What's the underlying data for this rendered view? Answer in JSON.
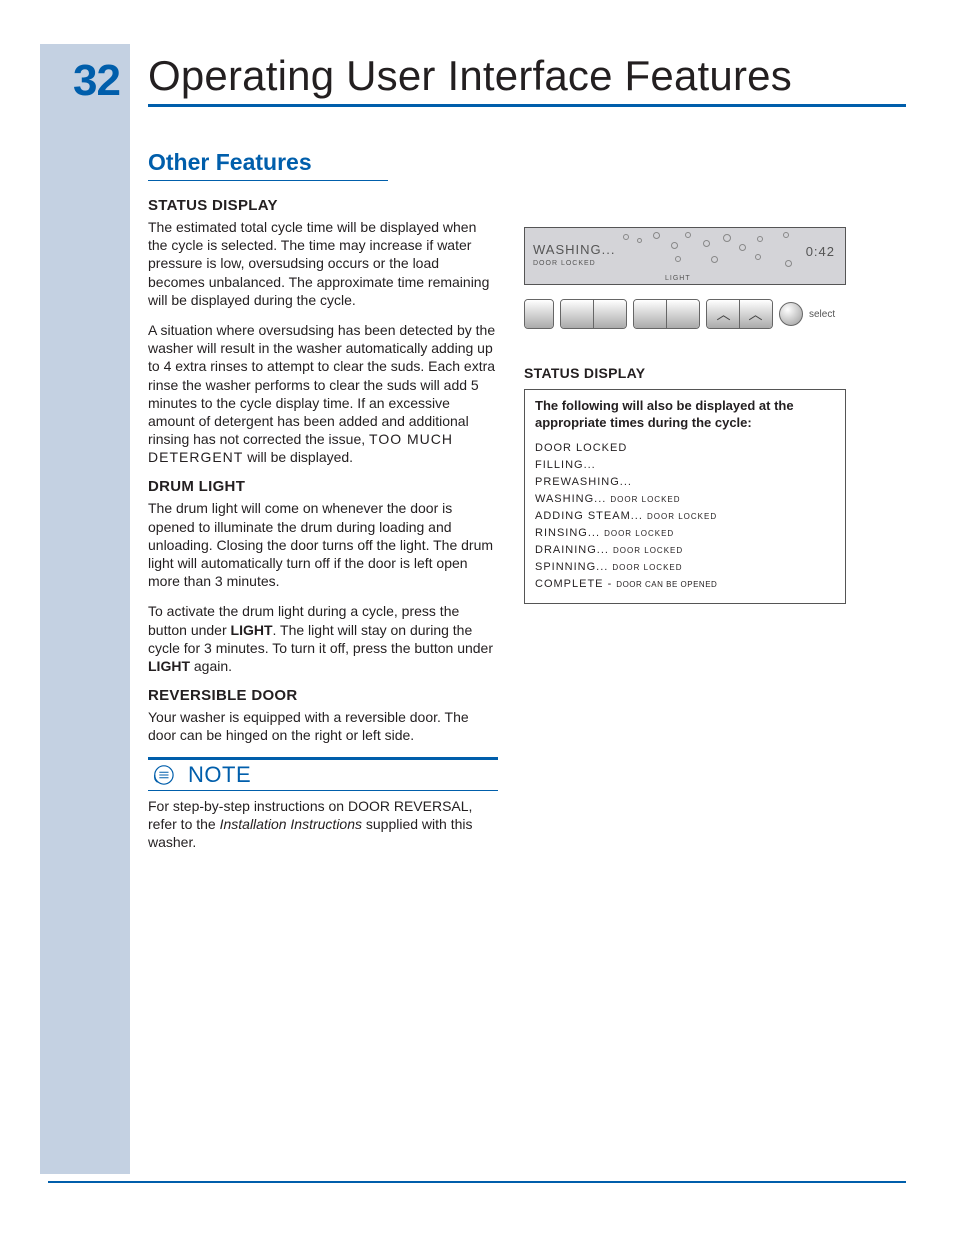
{
  "page_number": "32",
  "title": "Operating User Interface Features",
  "section_title": "Other Features",
  "left": {
    "status_display": {
      "heading": "STATUS DISPLAY",
      "p1": "The estimated total cycle time will be displayed when the cycle is selected. The time may increase if water pressure is low, oversudsing occurs or the load becomes unbalanced. The approximate time remaining will be displayed during the cycle.",
      "p2a": "A situation where oversudsing has been detected by the washer will result in the washer automatically adding up to 4 extra rinses to attempt to clear the suds. Each extra rinse the washer performs to clear the suds will add 5 minutes to the cycle display time. If an excessive amount of detergent has been added and additional rinsing has not corrected the issue, ",
      "p2_seg": "TOO MUCH DETERGENT",
      "p2b": " will be displayed."
    },
    "drum_light": {
      "heading": "DRUM LIGHT",
      "p1": "The drum light will come on whenever the door is opened to illuminate the drum during loading and unloading. Closing the door turns off the light. The drum light will automatically turn off if the door is left open more than 3 minutes.",
      "p2a": "To activate the drum light during a cycle, press the button under ",
      "p2_b1": "LIGHT",
      "p2b": ". The light will stay on during the cycle for 3 minutes. To turn it off, press the button under ",
      "p2_b2": "LIGHT",
      "p2c": " again."
    },
    "rev_door": {
      "heading": "REVERSIBLE DOOR",
      "p1": "Your washer is equipped with a reversible door. The door can be hinged on the right or left side."
    },
    "note": {
      "label": "NOTE",
      "body_a": "For step-by-step instructions on DOOR REVERSAL, refer to the ",
      "body_i": "Installation Instructions",
      "body_b": " supplied with this washer."
    }
  },
  "right": {
    "lcd": {
      "washing": "WASHING...",
      "door": "DOOR LOCKED",
      "timer": "0:42",
      "light": "LIGHT"
    },
    "select_label": "select",
    "status_heading": "STATUS DISPLAY",
    "status_intro": "The following will also be displayed at the appropriate times during the cycle:",
    "status_items": {
      "i0": "DOOR LOCKED",
      "i1": "FILLING...",
      "i2": "PREWASHING...",
      "i3": "WASHING...",
      "i3s": "DOOR LOCKED",
      "i4": "ADDING STEAM...",
      "i4s": "DOOR LOCKED",
      "i5": "RINSING...",
      "i5s": "DOOR LOCKED",
      "i6": "DRAINING...",
      "i6s": "DOOR LOCKED",
      "i7": "SPINNING...",
      "i7s": "DOOR LOCKED",
      "i8": "COMPLETE - ",
      "i8s": "DOOR CAN BE OPENED"
    }
  }
}
